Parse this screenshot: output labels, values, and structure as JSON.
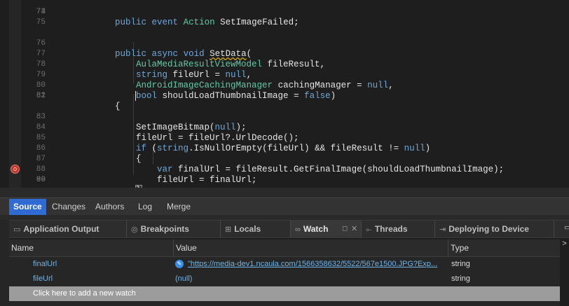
{
  "editor": {
    "lines": [
      {
        "num": "73",
        "text": "public event Action SetImageFailed;"
      },
      {
        "num": "74",
        "text": ""
      },
      {
        "num": "75",
        "text": ""
      },
      {
        "num": "76",
        "text": "public async void SetData("
      },
      {
        "num": "77",
        "text": "    AulaMediaResultViewModel fileResult,"
      },
      {
        "num": "78",
        "text": "    string fileUrl = null,"
      },
      {
        "num": "79",
        "text": "    AndroidImageCachingManager cachingManager = null,"
      },
      {
        "num": "80",
        "text": "    bool shouldLoadThumbnailImage = false)"
      },
      {
        "num": "81",
        "text": "{"
      },
      {
        "num": "82",
        "text": ""
      },
      {
        "num": "83",
        "text": "    SetImageBitmap(null);"
      },
      {
        "num": "84",
        "text": "    fileUrl = fileUrl?.UrlDecode();"
      },
      {
        "num": "85",
        "text": "    if (string.IsNullOrEmpty(fileUrl) && fileResult != null)"
      },
      {
        "num": "86",
        "text": "    {"
      },
      {
        "num": "87",
        "text": "        var finalUrl = fileResult.GetFinalImage(shouldLoadThumbnailImage);"
      },
      {
        "num": "88",
        "text": "        fileUrl = finalUrl;"
      },
      {
        "num": "89",
        "text": "    }"
      },
      {
        "num": "90",
        "text": ""
      }
    ]
  },
  "source_tabs": [
    "Source",
    "Changes",
    "Authors",
    "Log",
    "Merge"
  ],
  "pad_tabs": [
    {
      "label": "Application Output",
      "icon": "terminal-icon",
      "glyph": "▭"
    },
    {
      "label": "Breakpoints",
      "icon": "breakpoints-icon",
      "glyph": "◎"
    },
    {
      "label": "Locals",
      "icon": "locals-icon",
      "glyph": "⊞"
    },
    {
      "label": "Watch",
      "icon": "watch-icon",
      "glyph": "∞"
    },
    {
      "label": "Threads",
      "icon": "threads-icon",
      "glyph": "⟜"
    },
    {
      "label": "Deploying to Device",
      "icon": "deploy-icon",
      "glyph": "⇥"
    }
  ],
  "watch": {
    "headers": {
      "name": "Name",
      "value": "Value",
      "type": "Type"
    },
    "rows": [
      {
        "name": "finalUrl",
        "value": "\"https://media-dev1.ncaula.com/1566358632/5522/567e1500.JPG?Exp...",
        "type": "string"
      },
      {
        "name": "fileUrl",
        "value": "(null)",
        "type": "string"
      }
    ],
    "add_label": "Click here to add a new watch"
  },
  "colors": {
    "accent": "#2f6bd3",
    "keyword": "#6fa8dc",
    "type": "#63c8a8",
    "breakpoint": "#c0392b"
  }
}
